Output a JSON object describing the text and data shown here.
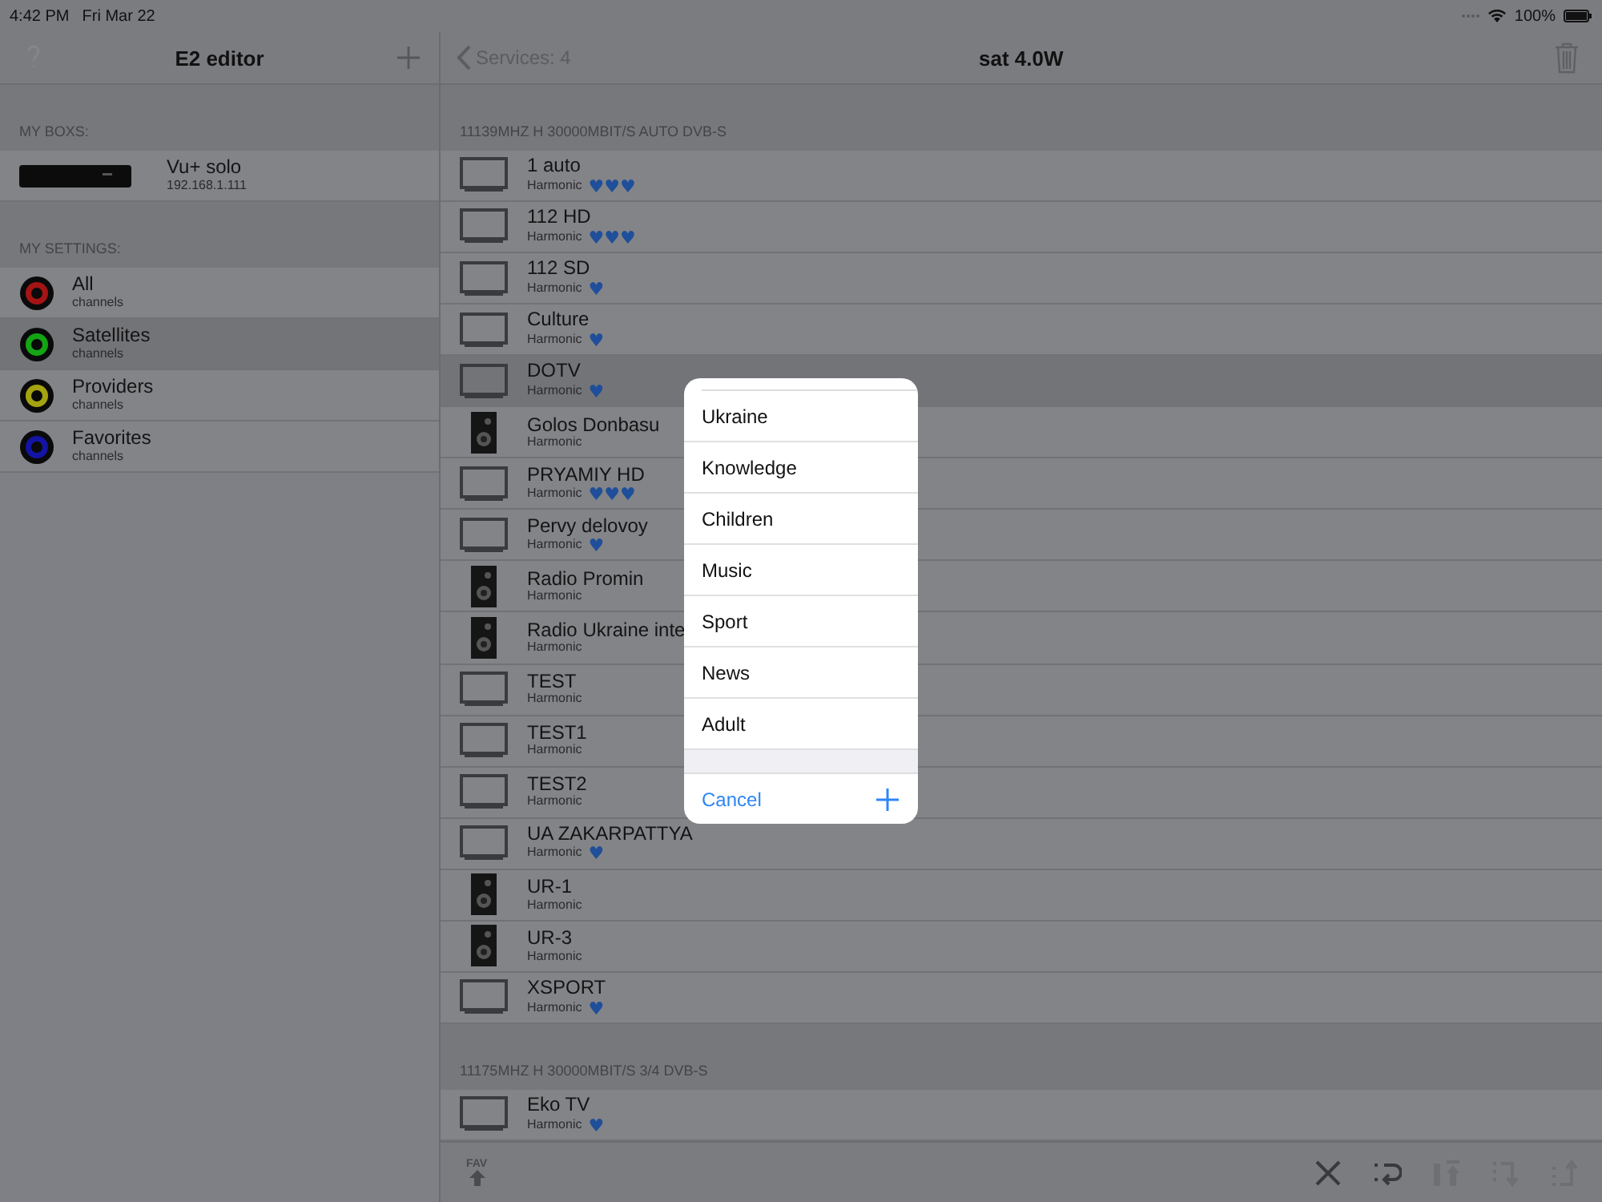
{
  "status_bar": {
    "time": "4:42 PM",
    "date": "Fri Mar 22",
    "battery": "100%"
  },
  "sidebar": {
    "title": "E2 editor",
    "boxes_header": "MY BOXS:",
    "boxes": [
      {
        "name": "Vu+ solo",
        "address": "192.168.1.111"
      }
    ],
    "settings_header": "MY SETTINGS:",
    "settings": [
      {
        "title": "All",
        "subtitle": "channels",
        "color": "#a41414",
        "selected": false
      },
      {
        "title": "Satellites",
        "subtitle": "channels",
        "color": "#14a414",
        "selected": true
      },
      {
        "title": "Providers",
        "subtitle": "channels",
        "color": "#a4a410",
        "selected": false
      },
      {
        "title": "Favorites",
        "subtitle": "channels",
        "color": "#1414a4",
        "selected": false
      }
    ]
  },
  "detail": {
    "back": "Services: 4",
    "title": "sat 4.0W",
    "sections": [
      {
        "header": "11139MHZ H 30000MBIT/S AUTO DVB-S",
        "rows": [
          {
            "kind": "tv",
            "name": "1 auto",
            "provider": "Harmonic",
            "hearts": "♥♥♥",
            "selected": false
          },
          {
            "kind": "tv",
            "name": "112 HD",
            "provider": "Harmonic",
            "hearts": "♥♥♥",
            "selected": false
          },
          {
            "kind": "tv",
            "name": "112 SD",
            "provider": "Harmonic",
            "hearts": "♥",
            "selected": false
          },
          {
            "kind": "tv",
            "name": "Culture",
            "provider": "Harmonic",
            "hearts": "♥",
            "selected": false
          },
          {
            "kind": "tv",
            "name": "DOTV",
            "provider": "Harmonic",
            "hearts": "♥",
            "selected": true
          },
          {
            "kind": "radio",
            "name": "Golos Donbasu",
            "provider": "Harmonic",
            "selected": false
          },
          {
            "kind": "tv",
            "name": "PRYAMIY HD",
            "provider": "Harmonic",
            "hearts": "♥♥♥",
            "selected": false
          },
          {
            "kind": "tv",
            "name": "Pervy delovoy",
            "provider": "Harmonic",
            "hearts": "♥",
            "selected": false
          },
          {
            "kind": "radio",
            "name": "Radio Promin",
            "provider": "Harmonic",
            "selected": false
          },
          {
            "kind": "radio",
            "name": "Radio Ukraine inte",
            "provider": "Harmonic",
            "selected": false
          },
          {
            "kind": "tv",
            "name": "TEST",
            "provider": "Harmonic",
            "selected": false
          },
          {
            "kind": "tv",
            "name": "TEST1",
            "provider": "Harmonic",
            "selected": false
          },
          {
            "kind": "tv",
            "name": "TEST2",
            "provider": "Harmonic",
            "selected": false
          },
          {
            "kind": "tv",
            "name": "UA ZAKARPATTYA",
            "provider": "Harmonic",
            "hearts": "♥",
            "selected": false
          },
          {
            "kind": "radio",
            "name": "UR-1",
            "provider": "Harmonic",
            "selected": false
          },
          {
            "kind": "radio",
            "name": "UR-3",
            "provider": "Harmonic",
            "selected": false
          },
          {
            "kind": "tv",
            "name": "XSPORT",
            "provider": "Harmonic",
            "hearts": "♥",
            "selected": false
          }
        ]
      },
      {
        "header": "11175MHZ H 30000MBIT/S 3/4 DVB-S",
        "rows": [
          {
            "kind": "tv",
            "name": "Eko TV",
            "provider": "Harmonic",
            "hearts": "♥",
            "selected": false
          }
        ]
      }
    ],
    "toolbar": {
      "fav": "FAV",
      "tools": [
        {
          "kind": "close",
          "disabled": false
        },
        {
          "kind": "swap",
          "disabled": false
        },
        {
          "kind": "top",
          "disabled": true
        },
        {
          "kind": "down",
          "disabled": true
        },
        {
          "kind": "up",
          "disabled": true
        }
      ]
    }
  },
  "popup": {
    "items": [
      "Ukraine",
      "Knowledge",
      "Children",
      "Music",
      "Sport",
      "News",
      "Adult"
    ],
    "cancel": "Cancel"
  }
}
